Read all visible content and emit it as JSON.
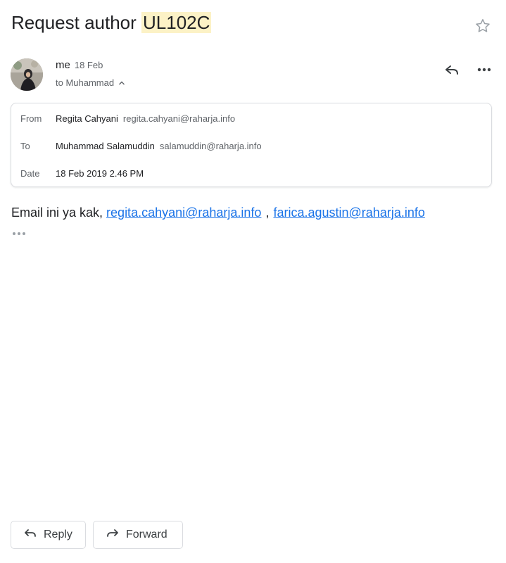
{
  "subject": {
    "prefix": "Request author ",
    "highlight": "UL102C"
  },
  "sender": {
    "name": "me",
    "date": "18 Feb",
    "to_line": "to Muhammad"
  },
  "details": {
    "from_label": "From",
    "from_name": "Regita Cahyani",
    "from_email": "regita.cahyani@raharja.info",
    "to_label": "To",
    "to_name": "Muhammad Salamuddin",
    "to_email": "salamuddin@raharja.info",
    "date_label": "Date",
    "date_value": "18 Feb 2019 2.46 PM"
  },
  "body": {
    "text": "Email ini ya kak, ",
    "link1": "regita.cahyani@raharja.info",
    "separator": ",",
    "link2": "farica.agustin@raharja.info"
  },
  "actions": {
    "reply_label": "Reply",
    "forward_label": "Forward"
  },
  "icons": {
    "star": "star-outline-icon",
    "reply": "reply-arrow-icon",
    "more": "more-horizontal-icon",
    "expand": "chevron-up-icon",
    "trimmed": "ellipsis-icon",
    "forward": "forward-arrow-icon"
  },
  "colors": {
    "highlight": "#fcf2c6",
    "link": "#1a73e8",
    "border": "#dadce0"
  }
}
